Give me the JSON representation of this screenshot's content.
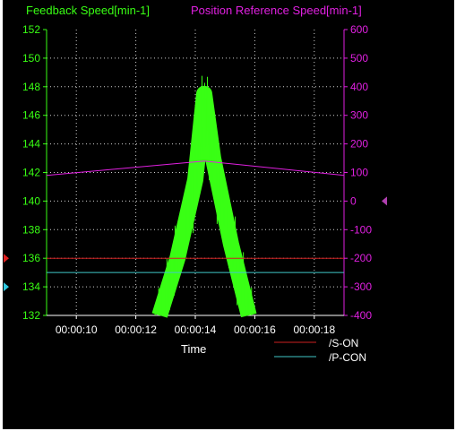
{
  "chart_data": {
    "type": "line",
    "left_axis": {
      "label": "Feedback Speed[min-1]",
      "color": "#39ff14",
      "ylim": [
        132,
        152
      ],
      "ticks": [
        132,
        134,
        136,
        138,
        140,
        142,
        144,
        146,
        148,
        150,
        152
      ]
    },
    "right_axis": {
      "label": "Position Reference Speed[min-1]",
      "color": "#e020e0",
      "ylim": [
        -400,
        600
      ],
      "ticks": [
        -400,
        -300,
        -200,
        -100,
        0,
        100,
        200,
        300,
        400,
        500,
        600
      ]
    },
    "x_axis": {
      "label": "Time",
      "range": [
        "00:00:09.00",
        "00:00:19.00"
      ],
      "ticks": [
        "00:00:10",
        "00:00:12",
        "00:00:14",
        "00:00:16",
        "00:00:18"
      ]
    },
    "grid": true,
    "series": [
      {
        "name": "Feedback Speed[min-1]",
        "axis": "left",
        "color": "#39ff14",
        "x": [
          "00:00:12.80",
          "00:00:13.40",
          "00:00:14.00",
          "00:00:14.30",
          "00:00:14.60",
          "00:00:15.20",
          "00:00:15.80"
        ],
        "y": [
          132,
          136,
          141.5,
          147.5,
          143,
          137,
          132
        ]
      },
      {
        "name": "Position Reference Speed[min-1]",
        "axis": "right",
        "color": "#e020e0",
        "x": [
          "00:00:09.00",
          "00:00:14.30",
          "00:00:19.00"
        ],
        "y": [
          90,
          140,
          90
        ]
      },
      {
        "name": "/S-ON",
        "axis": "left",
        "color": "#cc2020",
        "y_const": 136
      },
      {
        "name": "/P-CON",
        "axis": "left",
        "color": "#40c8c8",
        "y_const": 135
      }
    ],
    "legend": {
      "position": "bottom-right",
      "entries": [
        {
          "label": "/S-ON",
          "color": "#cc2020"
        },
        {
          "label": "/P-CON",
          "color": "#40c8c8"
        }
      ]
    },
    "markers": {
      "left": [
        {
          "value": 136,
          "color": "#e02020"
        },
        {
          "value": 134,
          "color": "#30c8e0"
        }
      ],
      "right": [
        {
          "value": 0,
          "color": "#b040b0"
        }
      ]
    }
  }
}
